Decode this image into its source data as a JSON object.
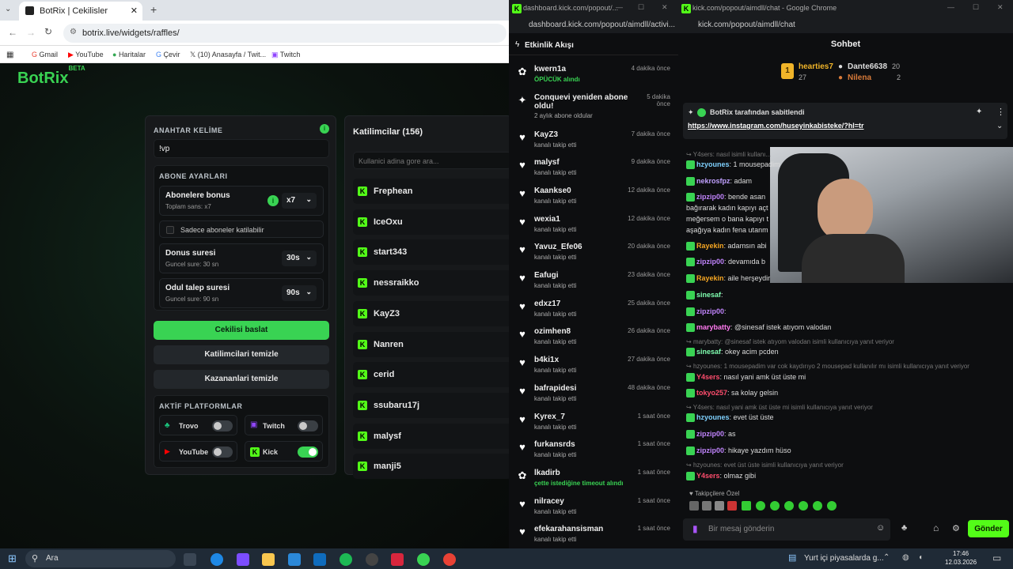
{
  "browser": {
    "tab_title": "BotRix | Cekilisler",
    "url": "botrix.live/widgets/raffles/",
    "bookmarks": [
      "Gmail",
      "YouTube",
      "Haritalar",
      "Çevir",
      "(10) Anasayfa / Twit...",
      "Twitch"
    ]
  },
  "botrix": {
    "logo": "BotRix",
    "logo_beta": "BETA",
    "keyword_label": "ANAHTAR KELİME",
    "keyword_value": "!vp",
    "sub_settings_label": "ABONE AYARLARI",
    "sub_bonus_title": "Abonelere bonus",
    "sub_bonus_sub": "Toplam sans: x7",
    "sub_bonus_value": "x7",
    "subs_only": "Sadece aboneler katilabilir",
    "duration_title": "Donus suresi",
    "duration_sub": "Guncel sure: 30 sn",
    "duration_value": "30s",
    "claim_title": "Odul talep suresi",
    "claim_sub": "Guncel sure: 90 sn",
    "claim_value": "90s",
    "start_btn": "Cekilisi baslat",
    "clear_participants_btn": "Katilimcilari temizle",
    "clear_winners_btn": "Kazananlari temizle",
    "platforms_label": "AKTİF PLATFORMLAR",
    "platforms": [
      {
        "name": "Trovo",
        "on": false
      },
      {
        "name": "Twitch",
        "on": false
      },
      {
        "name": "YouTube",
        "on": false
      },
      {
        "name": "Kick",
        "on": true
      }
    ],
    "participants_title": "Katilimcilar (156)",
    "search_placeholder": "Kullanici adina gore ara...",
    "participants": [
      "Frephean",
      "IceOxu",
      "start343",
      "nessraikko",
      "KayZ3",
      "Nanren",
      "cerid",
      "ssubaru17j",
      "malysf",
      "manji5"
    ]
  },
  "activity": {
    "window_title": "dashboard.kick.com/popout/...",
    "address": "dashboard.kick.com/popout/aimdll/activi...",
    "header": "Etkinlik Akışı",
    "items": [
      {
        "name": "kwern1a",
        "sub": "ÖPÜCÜK alındı",
        "time": "4 dakika önce",
        "icon": "gift"
      },
      {
        "name": "Conquevi yeniden abone oldu!",
        "sub": "2 aylık abone oldular",
        "time": "5 dakika önce",
        "icon": "star"
      },
      {
        "name": "KayZ3",
        "sub": "kanalı takip etti",
        "time": "7 dakika önce",
        "icon": "heart"
      },
      {
        "name": "malysf",
        "sub": "kanalı takip etti",
        "time": "9 dakika önce",
        "icon": "heart"
      },
      {
        "name": "Kaankse0",
        "sub": "kanalı takip etti",
        "time": "12 dakika önce",
        "icon": "heart"
      },
      {
        "name": "wexia1",
        "sub": "kanalı takip etti",
        "time": "12 dakika önce",
        "icon": "heart"
      },
      {
        "name": "Yavuz_Efe06",
        "sub": "kanalı takip etti",
        "time": "20 dakika önce",
        "icon": "heart"
      },
      {
        "name": "Eafugi",
        "sub": "kanalı takip etti",
        "time": "23 dakika önce",
        "icon": "heart"
      },
      {
        "name": "edxz17",
        "sub": "kanalı takip etti",
        "time": "25 dakika önce",
        "icon": "heart"
      },
      {
        "name": "ozimhen8",
        "sub": "kanalı takip etti",
        "time": "26 dakika önce",
        "icon": "heart"
      },
      {
        "name": "b4ki1x",
        "sub": "kanalı takip etti",
        "time": "27 dakika önce",
        "icon": "heart"
      },
      {
        "name": "bafrapidesi",
        "sub": "kanalı takip etti",
        "time": "48 dakika önce",
        "icon": "heart"
      },
      {
        "name": "Kyrex_7",
        "sub": "kanalı takip etti",
        "time": "1 saat önce",
        "icon": "heart"
      },
      {
        "name": "furkansrds",
        "sub": "kanalı takip etti",
        "time": "1 saat önce",
        "icon": "heart"
      },
      {
        "name": "lkadirb",
        "sub": "çette istediğine timeout alındı",
        "time": "1 saat önce",
        "icon": "gift"
      },
      {
        "name": "nilracey",
        "sub": "kanalı takip etti",
        "time": "1 saat önce",
        "icon": "heart"
      },
      {
        "name": "efekarahansisman",
        "sub": "kanalı takip etti",
        "time": "1 saat önce",
        "icon": "heart"
      }
    ]
  },
  "chat": {
    "window_title": "kick.com/popout/aimdll/chat - Google Chrome",
    "address": "kick.com/popout/aimdll/chat",
    "header": "Sohbet",
    "top": [
      {
        "name": "hearties7",
        "count": "27"
      },
      {
        "name": "Dante6638",
        "count": "20"
      },
      {
        "name": "Nilena",
        "count": "2"
      }
    ],
    "pinned_by": "BotRix tarafından sabitlendi",
    "pinned_link": "https://www.instagram.com/huseyinkabisteke/?hl=tr",
    "messages": [
      {
        "type": "reply",
        "text": "Y4sers: nasıl isimli kullanı..."
      },
      {
        "type": "msg",
        "user": "hzyounes",
        "color": "#7fd1ff",
        "text": "1 mousepadim"
      },
      {
        "type": "msg",
        "user": "nekrosfpz",
        "color": "#c0a0ff",
        "text": "adam"
      },
      {
        "type": "msg",
        "user": "zipzip00",
        "color": "#c084fc",
        "text": "bende asan"
      },
      {
        "type": "cont",
        "text": "bağırarak kadın kapıyı açt"
      },
      {
        "type": "cont",
        "text": "meğersem o bana kapıyı t"
      },
      {
        "type": "cont",
        "text": "aşağıya kadın fena utanm"
      },
      {
        "type": "msg",
        "user": "Rayekin",
        "color": "#f5a623",
        "text": "adamsın abi"
      },
      {
        "type": "msg",
        "user": "zipzip00",
        "color": "#c084fc",
        "text": "devamıda b"
      },
      {
        "type": "msg",
        "user": "Rayekin",
        "color": "#f5a623",
        "text": "aile herşeydir"
      },
      {
        "type": "msg",
        "user": "sinesaf",
        "color": "#7fffb0",
        "text": ""
      },
      {
        "type": "msg",
        "user": "zipzip00",
        "color": "#c084fc",
        "text": ""
      },
      {
        "type": "msg",
        "user": "marybatty",
        "color": "#ff7af0",
        "text": "@sinesaf istek atıyom valodan"
      },
      {
        "type": "reply",
        "text": "marybatty: @sinesaf istek atıyom valodan isimli kullanıcıya yanıt veriyor"
      },
      {
        "type": "msg",
        "user": "sinesaf",
        "color": "#7fffb0",
        "text": "okey acim pcden"
      },
      {
        "type": "reply",
        "text": "hzyounes: 1 mousepadim var cok kaydırıyo 2 mousepad kullanılır mı isimli kullanıcıya yanıt veriyor"
      },
      {
        "type": "msg",
        "user": "Y4sers",
        "color": "#ff4d6d",
        "text": "nasıl yani amk üst üste mi"
      },
      {
        "type": "msg",
        "user": "tokyo257",
        "color": "#ff4d6d",
        "text": "sa kolay gelsin"
      },
      {
        "type": "reply",
        "text": "Y4sers: nasıl yani amk üst üste mi isimli kullanıcıya yanıt veriyor"
      },
      {
        "type": "msg",
        "user": "hzyounes",
        "color": "#7fd1ff",
        "text": "evet üst üste"
      },
      {
        "type": "msg",
        "user": "zipzip00",
        "color": "#c084fc",
        "text": "as"
      },
      {
        "type": "msg",
        "user": "zipzip00",
        "color": "#c084fc",
        "text": "hikaye yazdım hüso"
      },
      {
        "type": "reply",
        "text": "hzyounes: evet üst üste isimli kullanıcıya yanıt veriyor"
      },
      {
        "type": "msg",
        "user": "Y4sers",
        "color": "#ff4d6d",
        "text": "olmaz gibi"
      }
    ],
    "followers_only": "Takipçilere Özel",
    "input_placeholder": "Bir mesaj gönderin",
    "send_btn": "Gönder"
  },
  "taskbar": {
    "search": "Ara",
    "news": "Yurt içi piyasalarda g...",
    "time": "17:46",
    "date": "12.03.2026"
  },
  "colors": {
    "kick_green": "#53fc18",
    "botrix_green": "#39d353"
  }
}
